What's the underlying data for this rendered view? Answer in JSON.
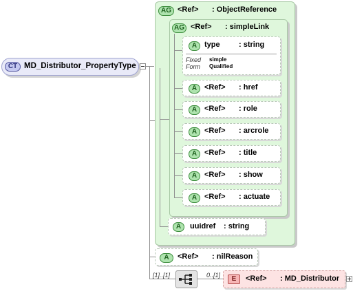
{
  "complex_type": {
    "badge": "CT",
    "name": "MD_Distributor_PropertyType"
  },
  "outer_group": {
    "badge": "AG",
    "ref": "<Ref>",
    "type": ": ObjectReference"
  },
  "inner_group": {
    "badge": "AG",
    "ref": "<Ref>",
    "type": ": simpleLink"
  },
  "type_attr": {
    "badge": "A",
    "name": "type",
    "type": ": string",
    "fixed_label": "Fixed",
    "form_label": "Form",
    "fixed_value": "simple",
    "form_value": "Qualified"
  },
  "attributes": [
    {
      "badge": "A",
      "ref": "<Ref>",
      "type": ": href"
    },
    {
      "badge": "A",
      "ref": "<Ref>",
      "type": ": role"
    },
    {
      "badge": "A",
      "ref": "<Ref>",
      "type": ": arcrole"
    },
    {
      "badge": "A",
      "ref": "<Ref>",
      "type": ": title"
    },
    {
      "badge": "A",
      "ref": "<Ref>",
      "type": ": show"
    },
    {
      "badge": "A",
      "ref": "<Ref>",
      "type": ": actuate"
    }
  ],
  "uuidref": {
    "badge": "A",
    "name": "uuidref",
    "type": ": string"
  },
  "nil_reason": {
    "badge": "A",
    "ref": "<Ref>",
    "type": ": nilReason"
  },
  "sequence": {
    "multiplicity": "[1]..[1]"
  },
  "element": {
    "badge": "E",
    "ref": "<Ref>",
    "type": ": MD_Distributor",
    "multiplicity": "0..[1]"
  },
  "colors": {
    "attribute_green": "#aee3ae",
    "group_bg": "#dff7dc",
    "complex_type_blue": "#c4c8f0",
    "element_red": "#f7b6b6"
  }
}
